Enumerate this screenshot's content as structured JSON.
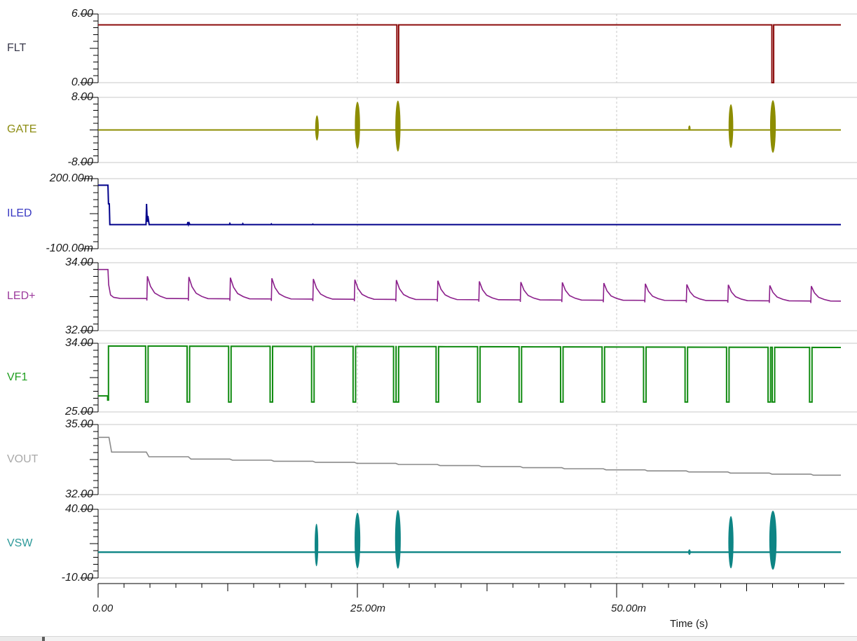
{
  "chart_data": {
    "type": "line",
    "title": "",
    "xlabel": "Time (s)",
    "x_axis": {
      "unit": "ms",
      "t_max_ms": 71.6,
      "minor_step_ms": 2.5,
      "ticks": [
        {
          "t": 0,
          "label": "0.00"
        },
        {
          "t": 25,
          "label": "25.00m"
        },
        {
          "t": 50,
          "label": "50.00m"
        }
      ],
      "grid_dashed_at": [
        25,
        50
      ]
    },
    "grid_color": "#c9c9c9",
    "axis_color": "#000000",
    "plots": [
      {
        "id": "flt",
        "label": "FLT",
        "label_color": "#3b3b4d",
        "color": "#8b0b0b",
        "y_max": 6,
        "y_min": 0,
        "y_top_label": "6.00",
        "y_bottom_label": "0.00",
        "kind": "line",
        "stroke": 2,
        "points": [
          [
            0,
            5.05
          ],
          [
            28.8,
            5.05
          ],
          [
            28.8,
            0
          ],
          [
            28.97,
            0
          ],
          [
            28.97,
            5.05
          ],
          [
            64.95,
            5.05
          ],
          [
            64.95,
            0
          ],
          [
            65.12,
            0
          ],
          [
            65.12,
            5.05
          ],
          [
            71.6,
            5.05
          ]
        ]
      },
      {
        "id": "gate",
        "label": "GATE",
        "label_color": "#8d8d13",
        "color": "#8d8d00",
        "y_max": 8,
        "y_min": -8,
        "y_top_label": "8.00",
        "y_bottom_label": "-8.00",
        "kind": "baseline_bursts",
        "stroke": 2,
        "base": 0,
        "bursts": [
          {
            "t": 21.1,
            "hi": 3.6,
            "lo": -2.6,
            "w": 0.35
          },
          {
            "t": 25.0,
            "hi": 6.9,
            "lo": -4.6,
            "w": 0.5
          },
          {
            "t": 28.9,
            "hi": 7.2,
            "lo": -5.3,
            "w": 0.5
          },
          {
            "t": 57.0,
            "hi": 1.1,
            "lo": -0.2,
            "w": 0.2
          },
          {
            "t": 61.0,
            "hi": 6.3,
            "lo": -4.4,
            "w": 0.45
          },
          {
            "t": 65.05,
            "hi": 7.3,
            "lo": -5.6,
            "w": 0.55
          }
        ]
      },
      {
        "id": "iled",
        "label": "ILED",
        "label_color": "#3939c2",
        "color": "#00008b",
        "y_max": 200,
        "y_min": -100,
        "y_top_label": "200.00m",
        "y_bottom_label": "-100.00m",
        "kind": "line",
        "stroke": 2,
        "points": [
          [
            0,
            172
          ],
          [
            0.95,
            172
          ],
          [
            1.0,
            92
          ],
          [
            1.08,
            92
          ],
          [
            1.13,
            3
          ],
          [
            4.62,
            3
          ],
          [
            4.67,
            92
          ],
          [
            4.74,
            15
          ],
          [
            4.8,
            40
          ],
          [
            4.92,
            3
          ],
          [
            8.6,
            3
          ],
          [
            8.65,
            14
          ],
          [
            8.72,
            3
          ],
          [
            8.78,
            10
          ],
          [
            8.85,
            3
          ],
          [
            12.65,
            3
          ],
          [
            12.7,
            8
          ],
          [
            12.76,
            3
          ],
          [
            13.9,
            3
          ],
          [
            13.95,
            7
          ],
          [
            14.0,
            3
          ],
          [
            16.65,
            3
          ],
          [
            16.7,
            6
          ],
          [
            16.75,
            3
          ],
          [
            20.65,
            3
          ],
          [
            20.7,
            5
          ],
          [
            20.75,
            3
          ],
          [
            71.6,
            3
          ]
        ]
      },
      {
        "id": "ledp",
        "label": "LED+",
        "label_color": "#9c3a9c",
        "color": "#8b1f8b",
        "y_max": 34,
        "y_min": 32,
        "y_top_label": "34.00",
        "y_bottom_label": "32.00",
        "kind": "bumps",
        "stroke": 1.6,
        "start": {
          "level": 33.8,
          "until": 0.95,
          "fall": [
            [
              1.02,
              33.35
            ],
            [
              1.2,
              33.05
            ],
            [
              1.5,
              32.98
            ],
            [
              2.1,
              32.95
            ]
          ]
        },
        "baseline": {
          "t0": 2.1,
          "v0": 32.95,
          "t1": 71.6,
          "v1": 32.87
        },
        "undershoot": 0.06,
        "events": [
          {
            "t": 4.7,
            "p": 33.6
          },
          {
            "t": 8.7,
            "p": 33.58
          },
          {
            "t": 12.7,
            "p": 33.56
          },
          {
            "t": 16.7,
            "p": 33.54
          },
          {
            "t": 20.7,
            "p": 33.52
          },
          {
            "t": 24.7,
            "p": 33.5
          },
          {
            "t": 28.7,
            "p": 33.49
          },
          {
            "t": 32.7,
            "p": 33.47
          },
          {
            "t": 36.7,
            "p": 33.45
          },
          {
            "t": 40.7,
            "p": 33.43
          },
          {
            "t": 44.7,
            "p": 33.42
          },
          {
            "t": 48.7,
            "p": 33.4
          },
          {
            "t": 52.7,
            "p": 33.38
          },
          {
            "t": 56.7,
            "p": 33.36
          },
          {
            "t": 60.7,
            "p": 33.35
          },
          {
            "t": 64.7,
            "p": 33.33
          },
          {
            "t": 68.7,
            "p": 33.31
          }
        ]
      },
      {
        "id": "vf1",
        "label": "VF1",
        "label_color": "#1f9e1f",
        "color": "#118b11",
        "y_max": 34,
        "y_min": 25,
        "y_top_label": "34.00",
        "y_bottom_label": "25.00",
        "kind": "square",
        "stroke": 2,
        "low_start": {
          "level": 27.1,
          "until": 0.92,
          "notch": 26.55
        },
        "high_start": 33.65,
        "high_end": 33.45,
        "dip_level": 26.3,
        "dip_halfwidth": 0.12,
        "dips": [
          4.7,
          8.7,
          12.7,
          16.7,
          20.7,
          24.7,
          28.6,
          28.85,
          32.7,
          36.7,
          40.7,
          44.7,
          48.7,
          52.7,
          56.7,
          60.7,
          64.7,
          65.1,
          68.7
        ]
      },
      {
        "id": "vout",
        "label": "VOUT",
        "label_color": "#a9a9a9",
        "color": "#8a8a8a",
        "y_max": 35,
        "y_min": 32,
        "y_top_label": "35.00",
        "y_bottom_label": "32.00",
        "kind": "steps",
        "stroke": 1.6,
        "end_t": 71.6,
        "steps": [
          {
            "t": 0,
            "v": 34.45
          },
          {
            "t": 1.05,
            "v": 33.82
          },
          {
            "t": 4.65,
            "v": 33.62
          },
          {
            "t": 8.7,
            "v": 33.52
          },
          {
            "t": 12.7,
            "v": 33.474
          },
          {
            "t": 16.7,
            "v": 33.428
          },
          {
            "t": 20.7,
            "v": 33.382
          },
          {
            "t": 24.7,
            "v": 33.336
          },
          {
            "t": 28.7,
            "v": 33.29
          },
          {
            "t": 32.7,
            "v": 33.244
          },
          {
            "t": 36.7,
            "v": 33.198
          },
          {
            "t": 40.7,
            "v": 33.152
          },
          {
            "t": 44.7,
            "v": 33.106
          },
          {
            "t": 48.7,
            "v": 33.06
          },
          {
            "t": 52.7,
            "v": 33.014
          },
          {
            "t": 56.7,
            "v": 32.968
          },
          {
            "t": 60.7,
            "v": 32.922
          },
          {
            "t": 64.7,
            "v": 32.876
          },
          {
            "t": 68.7,
            "v": 32.83
          }
        ]
      },
      {
        "id": "vsw",
        "label": "VSW",
        "label_color": "#2e9a9a",
        "color": "#0e8585",
        "y_max": 40,
        "y_min": -10,
        "y_top_label": "40.00",
        "y_bottom_label": "-10.00",
        "kind": "baseline_bursts",
        "stroke": 2.4,
        "base": 8.8,
        "bursts": [
          {
            "t": 21.05,
            "hi": 29.5,
            "lo": -1.5,
            "w": 0.35
          },
          {
            "t": 25.0,
            "hi": 37.5,
            "lo": -3.0,
            "w": 0.55
          },
          {
            "t": 28.9,
            "hi": 39.5,
            "lo": -3.2,
            "w": 0.55
          },
          {
            "t": 57.0,
            "hi": 10.8,
            "lo": 6.8,
            "w": 0.25
          },
          {
            "t": 61.0,
            "hi": 35.0,
            "lo": -3.0,
            "w": 0.5
          },
          {
            "t": 65.05,
            "hi": 39.0,
            "lo": -4.0,
            "w": 0.7
          }
        ]
      }
    ]
  }
}
